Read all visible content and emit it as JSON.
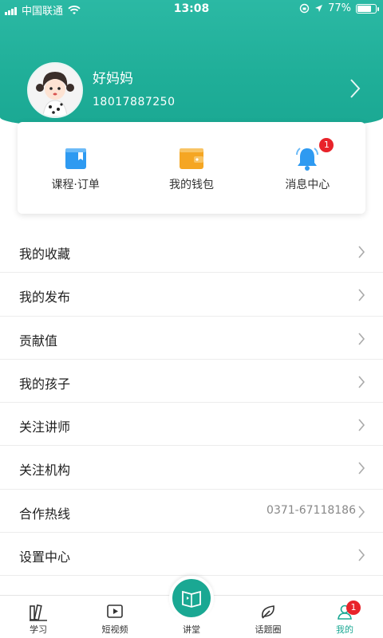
{
  "status_bar": {
    "carrier": "中国联通",
    "time": "13:08",
    "battery_percent": "77%",
    "battery_level": 0.77
  },
  "profile": {
    "name": "好妈妈",
    "phone": "18017887250"
  },
  "quick_actions": [
    {
      "label": "课程·订单",
      "icon": "book-icon",
      "color": "#2e9af1"
    },
    {
      "label": "我的钱包",
      "icon": "wallet-icon",
      "color": "#f5a623"
    },
    {
      "label": "消息中心",
      "icon": "bell-icon",
      "color": "#2e9af1",
      "badge": "1"
    }
  ],
  "menu": [
    {
      "label": "我的收藏"
    },
    {
      "label": "我的发布"
    },
    {
      "label": "贡献值"
    },
    {
      "label": "我的孩子"
    },
    {
      "label": "关注讲师"
    },
    {
      "label": "关注机构"
    },
    {
      "label": "合作热线",
      "value": "0371-67118186"
    },
    {
      "label": "设置中心"
    }
  ],
  "tabbar": [
    {
      "label": "学习",
      "icon": "books-icon"
    },
    {
      "label": "短视频",
      "icon": "video-icon"
    },
    {
      "label": "讲堂",
      "icon": "lecture-icon"
    },
    {
      "label": "话题圈",
      "icon": "leaf-icon"
    },
    {
      "label": "我的",
      "icon": "user-icon",
      "badge": "1",
      "active": true
    }
  ],
  "colors": {
    "accent": "#1aa893",
    "badge": "#e8232a"
  }
}
